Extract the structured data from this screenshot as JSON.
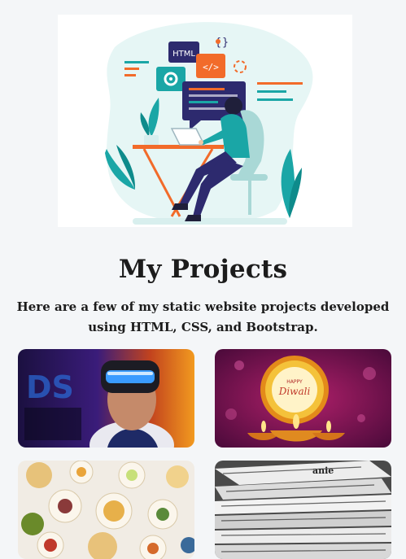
{
  "hero": {
    "illustration": "developer-at-laptop-illustration",
    "badges": [
      "HTML",
      "{•}",
      "</>"
    ]
  },
  "section": {
    "title": "My Projects",
    "subtitle": "Here are a few of my static website projects developed using HTML, CSS, and Bootstrap."
  },
  "projects": [
    {
      "name": "vr-project-thumbnail"
    },
    {
      "name": "diwali-project-thumbnail",
      "badge_top": "HAPPY",
      "badge_main": "Diwali"
    },
    {
      "name": "food-project-thumbnail"
    },
    {
      "name": "newspaper-project-thumbnail"
    }
  ],
  "colors": {
    "page_bg": "#f4f6f8",
    "accent_orange": "#f26b2a",
    "accent_teal": "#1aa6a6",
    "navy": "#2d2a6e"
  }
}
